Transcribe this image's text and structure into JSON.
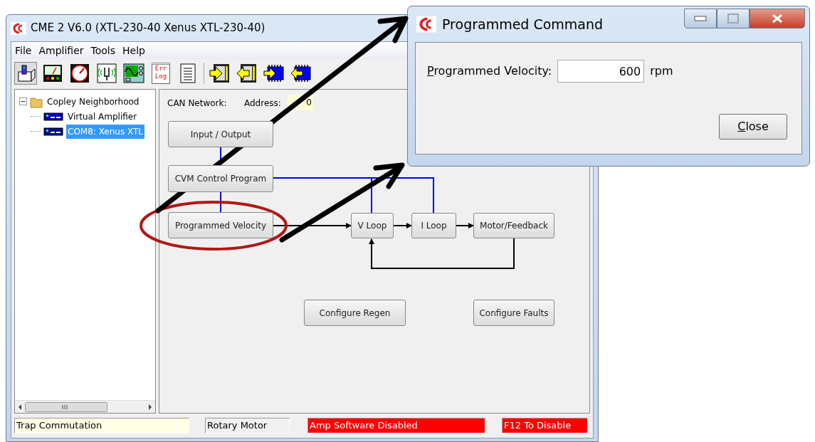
{
  "main_window": {
    "title": "CME 2 V6.0 (XTL-230-40 Xenus XTL-230-40)",
    "menu": [
      "File",
      "Amplifier",
      "Tools",
      "Help"
    ],
    "toolbar": {
      "error_log_label": [
        "Err",
        "Log"
      ]
    },
    "tree": {
      "label": "Copley Neighborhood",
      "expanded": true,
      "children": [
        {
          "label": "Virtual Amplifier",
          "selected": false
        },
        {
          "label": "COM8: Xenus XTL",
          "selected": true
        }
      ]
    },
    "can_network": {
      "label": "CAN Network:",
      "address_label": "Address:",
      "address": "0"
    },
    "diagram": {
      "blocks": [
        "Input / Output",
        "CVM Control Program",
        "Programmed Velocity",
        "V Loop",
        "I Loop",
        "Motor/Feedback"
      ],
      "buttons": [
        "Configure Regen",
        "Configure Faults"
      ]
    },
    "status_bar": [
      {
        "text": "Trap Commutation",
        "color": "#ffffe6"
      },
      {
        "text": "Rotary Motor",
        "color": "#f0f0f0"
      },
      {
        "text": "Amp Software Disabled",
        "color": "#ff0000"
      },
      {
        "text": "F12 To Disable",
        "color": "#ff0000"
      }
    ]
  },
  "dialog": {
    "title": "Programmed Command",
    "field_label": "Programmed Velocity:",
    "value": "600",
    "unit": "rpm",
    "button": "Close"
  }
}
